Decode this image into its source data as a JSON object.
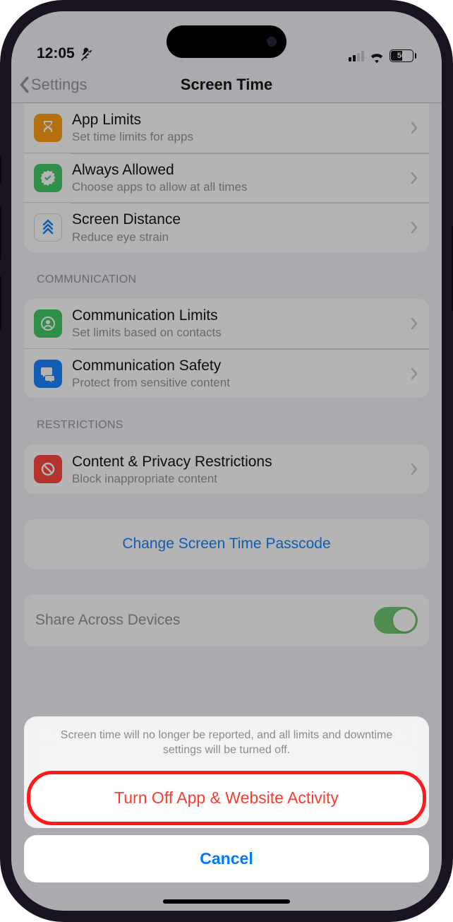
{
  "status": {
    "time": "12:05",
    "battery_text": "50"
  },
  "nav": {
    "back_label": "Settings",
    "title": "Screen Time"
  },
  "group1": {
    "app_limits": {
      "title": "App Limits",
      "sub": "Set time limits for apps"
    },
    "always_allowed": {
      "title": "Always Allowed",
      "sub": "Choose apps to allow at all times"
    },
    "screen_distance": {
      "title": "Screen Distance",
      "sub": "Reduce eye strain"
    }
  },
  "section_communication": "Communication",
  "group2": {
    "comm_limits": {
      "title": "Communication Limits",
      "sub": "Set limits based on contacts"
    },
    "comm_safety": {
      "title": "Communication Safety",
      "sub": "Protect from sensitive content"
    }
  },
  "section_restrictions": "Restrictions",
  "group3": {
    "content_privacy": {
      "title": "Content & Privacy Restrictions",
      "sub": "Block inappropriate content"
    }
  },
  "change_passcode": "Change Screen Time Passcode",
  "share_devices": "Share Across Devices",
  "sheet": {
    "message": "Screen time will no longer be reported, and all limits and downtime settings will be turned off.",
    "destructive": "Turn Off App & Website Activity",
    "cancel": "Cancel"
  }
}
